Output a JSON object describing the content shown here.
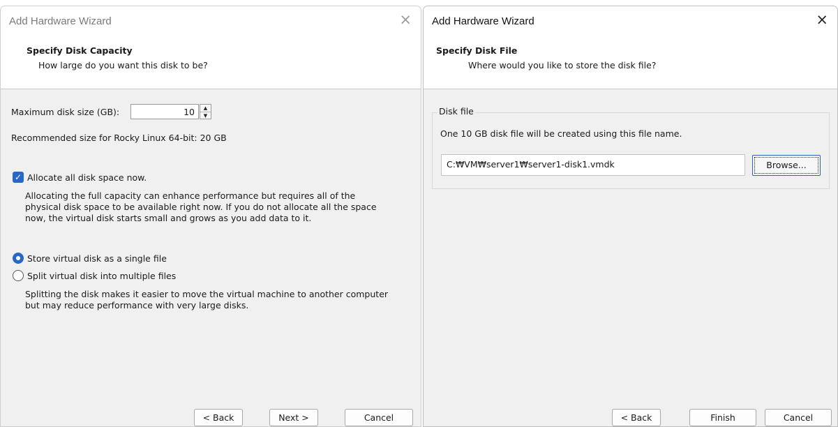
{
  "left_window": {
    "title": "Add Hardware Wizard",
    "close_glyph": "×",
    "header_title": "Specify Disk Capacity",
    "header_subtitle": "How large do you want this disk to be?",
    "max_size_label": "Maximum disk size (GB):",
    "max_size_value": "10",
    "recommended_text": "Recommended size for Rocky Linux 64-bit: 20 GB",
    "allocate_checked": true,
    "allocate_label": "Allocate all disk space now.",
    "allocate_desc_lines": [
      "Allocating the full capacity can enhance performance but requires all of the",
      "physical disk space to be available right now. If you do not allocate all the space",
      "now, the virtual disk starts small and grows as you add data to it."
    ],
    "selected_storage_option": "single",
    "single_file_label": "Store virtual disk as a single file",
    "split_label": "Split virtual disk into multiple files",
    "split_desc_lines": [
      "Splitting the disk makes it easier to move the virtual machine to another computer",
      "but may reduce performance with very large disks."
    ],
    "buttons": {
      "back": "< Back",
      "next": "Next >",
      "cancel": "Cancel"
    }
  },
  "right_window": {
    "title": "Add Hardware Wizard",
    "close_glyph": "×",
    "header_title": "Specify Disk File",
    "header_subtitle": "Where would you like to store the disk file?",
    "group_label": "Disk file",
    "info_text": "One 10 GB disk file will be created using this file name.",
    "file_path": "C:₩VM₩server1₩server1-disk1.vmdk",
    "browse_label": "Browse...",
    "buttons": {
      "back": "< Back",
      "finish": "Finish",
      "cancel": "Cancel"
    }
  },
  "colors": {
    "accent": "#2967c7",
    "dialog_bg": "#f0f0f0",
    "header_bg": "#ffffff"
  }
}
